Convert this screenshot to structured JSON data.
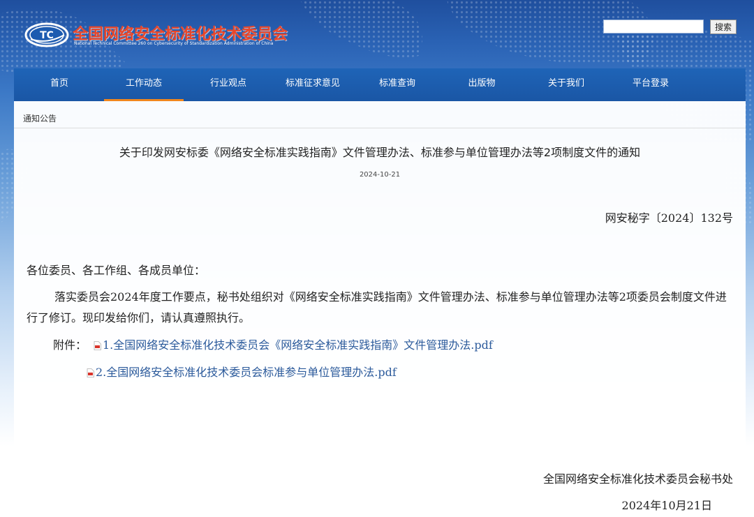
{
  "header": {
    "site_title": "全国网络安全标准化技术委员会",
    "site_subtitle": "National Technical Committee 260 on Cybersecurity of Standardization Administration of China",
    "logo_text": "TC",
    "search_placeholder": "",
    "search_button": "搜索"
  },
  "nav": {
    "items": [
      {
        "label": "首页"
      },
      {
        "label": "工作动态"
      },
      {
        "label": "行业观点"
      },
      {
        "label": "标准征求意见"
      },
      {
        "label": "标准查询"
      },
      {
        "label": "出版物"
      },
      {
        "label": "关于我们"
      },
      {
        "label": "平台登录"
      }
    ],
    "active_index": 1
  },
  "breadcrumb": "通知公告",
  "article": {
    "title": "关于印发网安标委《网络安全标准实践指南》文件管理办法、标准参与单位管理办法等2项制度文件的通知",
    "date": "2024-10-21",
    "doc_number": "网安秘字〔2024〕132号",
    "salutation": "各位委员、各工作组、各成员单位：",
    "body": "落实委员会2024年度工作要点，秘书处组织对《网络安全标准实践指南》文件管理办法、标准参与单位管理办法等2项委员会制度文件进行了修订。现印发给你们，请认真遵照执行。",
    "attachments_label": "附件：",
    "attachments": [
      {
        "label": "1.全国网络安全标准化技术委员会《网络安全标准实践指南》文件管理办法.pdf",
        "icon": "pdf-icon"
      },
      {
        "label": "2.全国网络安全标准化技术委员会标准参与单位管理办法.pdf",
        "icon": "pdf-icon"
      }
    ],
    "signature": "全国网络安全标准化技术委员会秘书处",
    "sign_date": "2024年10月21日"
  },
  "colors": {
    "title_red": "#e8472b",
    "nav_blue": "#1a56a5",
    "active_underline": "#f0861e",
    "link_blue": "#2b5a9b"
  }
}
